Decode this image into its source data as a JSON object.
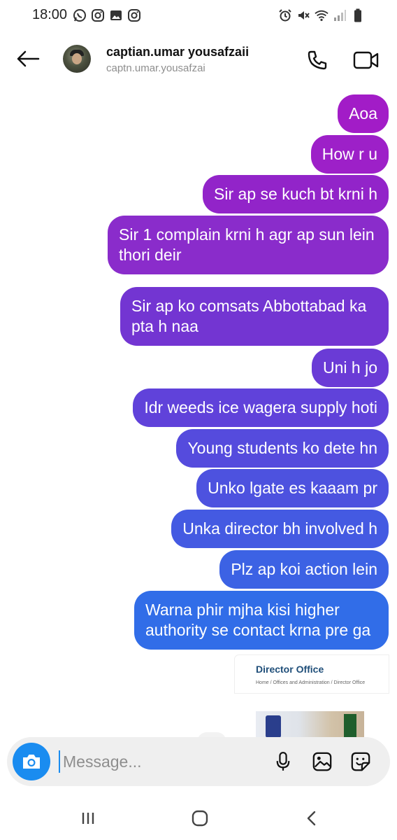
{
  "status_bar": {
    "time": "18:00",
    "left_icons": [
      "whatsapp-icon",
      "instagram-icon",
      "gallery-icon",
      "instagram-icon"
    ],
    "right_icons": [
      "alarm-icon",
      "mute-icon",
      "wifi-icon",
      "signal-icon",
      "battery-icon"
    ]
  },
  "header": {
    "back_icon": "back-arrow-icon",
    "contact_name": "captian.umar yousafzaii",
    "username": "captn.umar.yousafzai",
    "call_icon": "phone-icon",
    "video_icon": "video-camera-icon"
  },
  "messages": [
    {
      "text": "Aoa"
    },
    {
      "text": "How r u"
    },
    {
      "text": "Sir ap se kuch bt krni h"
    },
    {
      "text": "Sir 1 complain krni h agr ap sun lein thori deir"
    },
    {
      "text": "Sir ap ko comsats Abbottabad ka pta h naa"
    },
    {
      "text": "Uni h jo"
    },
    {
      "text": "Idr weeds ice wagera supply hoti"
    },
    {
      "text": "Young students ko dete hn"
    },
    {
      "text": "Unko lgate es kaaam pr"
    },
    {
      "text": "Unka director bh involved h"
    },
    {
      "text": "Plz ap koi action lein"
    },
    {
      "text": "Warna phir mjha kisi higher authority se contact krna pre ga"
    }
  ],
  "shared_card": {
    "title": "Director Office",
    "breadcrumb": "Home  /  Offices and Administration  /  Director Office"
  },
  "composer": {
    "placeholder": "Message...",
    "camera_icon": "camera-icon",
    "mic_icon": "microphone-icon",
    "gallery_icon": "gallery-icon",
    "sticker_icon": "sticker-icon"
  },
  "nav_bar": {
    "icons": [
      "recent-apps-icon",
      "home-icon",
      "back-icon"
    ]
  },
  "colors": {
    "gradient_top": "#a21cc7",
    "gradient_mid": "#6b3fd8",
    "gradient_bottom": "#2f6fe8",
    "composer_bg": "#efefef",
    "camera_button": "#1a8cf0"
  }
}
